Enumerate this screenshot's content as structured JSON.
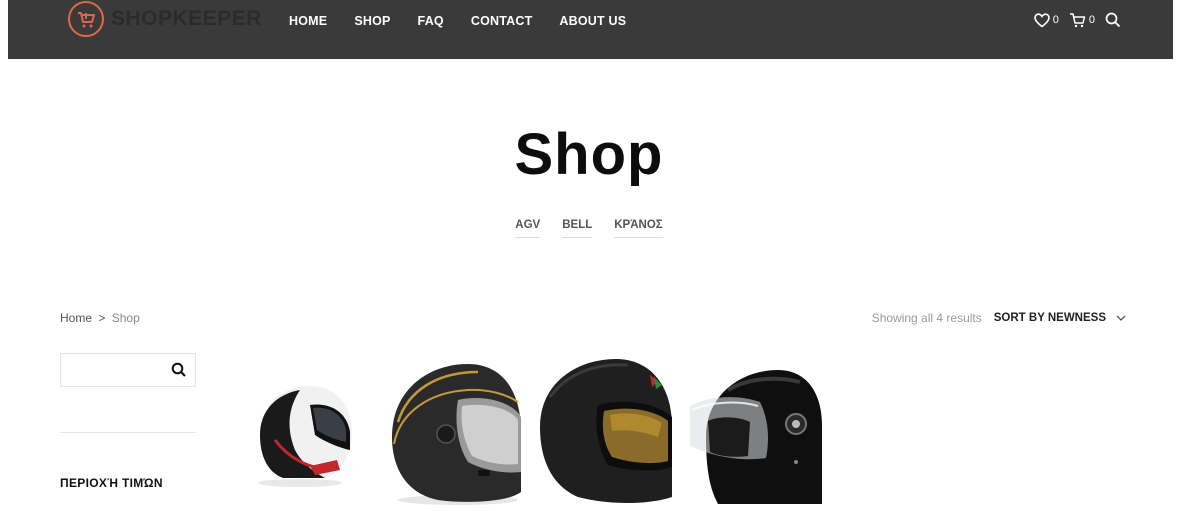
{
  "header": {
    "logo_text": "SHOPKEEPER",
    "nav": [
      "HOME",
      "SHOP",
      "FAQ",
      "CONTACT",
      "ABOUT US"
    ],
    "wishlist_count": "0",
    "cart_count": "0",
    "icons": [
      "cart-logo-icon",
      "heart-icon",
      "cart-icon",
      "search-icon"
    ],
    "colors": {
      "bar": "#3a3a3a",
      "logo_accent": "#e2674a"
    }
  },
  "page": {
    "title": "Shop",
    "categories": [
      "AGV",
      "BELL",
      "ΚΡΆΝΟΣ"
    ]
  },
  "breadcrumb": {
    "home": "Home",
    "separator": ">",
    "current": "Shop"
  },
  "results": {
    "count_text": "Showing all 4 results",
    "sort_label": "SORT BY NEWNESS"
  },
  "sidebar": {
    "search_placeholder": "",
    "price_widget_title": "ΠΕΡΙΟΧΉ ΤΙΜΏΝ"
  },
  "products": [
    {
      "image": "white-black-bell-helmet"
    },
    {
      "image": "matte-black-gold-bell-helmet"
    },
    {
      "image": "carbon-agv-helmet-gold-visor"
    },
    {
      "image": "gloss-black-retro-helmet"
    }
  ]
}
